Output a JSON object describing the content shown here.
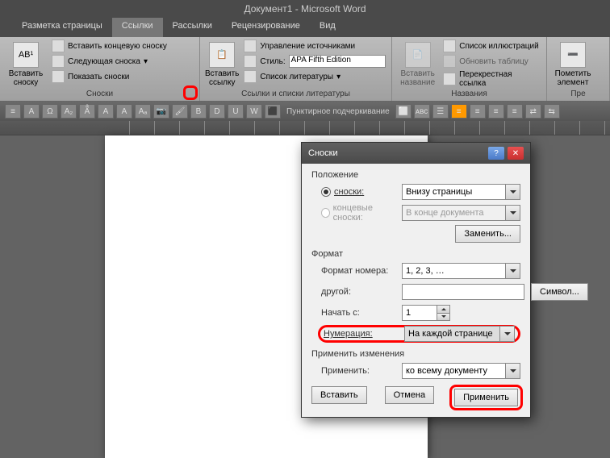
{
  "titlebar": "Документ1 - Microsoft Word",
  "tabs": [
    "Разметка страницы",
    "Ссылки",
    "Рассылки",
    "Рецензирование",
    "Вид"
  ],
  "active_tab_index": 1,
  "ribbon": {
    "footnotes": {
      "insert_footnote": "Вставить сноску",
      "insert_endnote": "Вставить концевую сноску",
      "next_footnote": "Следующая сноска",
      "show_notes": "Показать сноски",
      "group_label": "Сноски"
    },
    "citations": {
      "insert_citation": "Вставить ссылку",
      "manage_sources": "Управление источниками",
      "style_label": "Стиль:",
      "style_value": "APA Fifth Edition",
      "bibliography": "Список литературы",
      "group_label": "Ссылки и списки литературы"
    },
    "captions": {
      "insert_caption": "Вставить название",
      "table_of_figures": "Список иллюстраций",
      "update_table": "Обновить таблицу",
      "cross_reference": "Перекрестная ссылка",
      "group_label": "Названия"
    },
    "index": {
      "mark_entry": "Пометить элемент",
      "group_label": "Пре"
    }
  },
  "quicktoolbar_label": "Пунктирное подчеркивание",
  "dialog": {
    "title": "Сноски",
    "position": {
      "legend": "Положение",
      "footnotes_label": "сноски:",
      "footnotes_value": "Внизу страницы",
      "endnotes_label": "концевые сноски:",
      "endnotes_value": "В конце документа",
      "change_btn": "Заменить..."
    },
    "format": {
      "legend": "Формат",
      "number_format_label": "Формат номера:",
      "number_format_value": "1, 2, 3, …",
      "custom_label": "другой:",
      "custom_value": "",
      "symbol_btn": "Символ...",
      "start_at_label": "Начать с:",
      "start_at_value": "1",
      "numbering_label": "Нумерация:",
      "numbering_value": "На каждой странице"
    },
    "apply": {
      "legend": "Применить изменения",
      "apply_to_label": "Применить:",
      "apply_to_value": "ко всему документу"
    },
    "buttons": {
      "insert": "Вставить",
      "cancel": "Отмена",
      "apply": "Применить"
    }
  }
}
